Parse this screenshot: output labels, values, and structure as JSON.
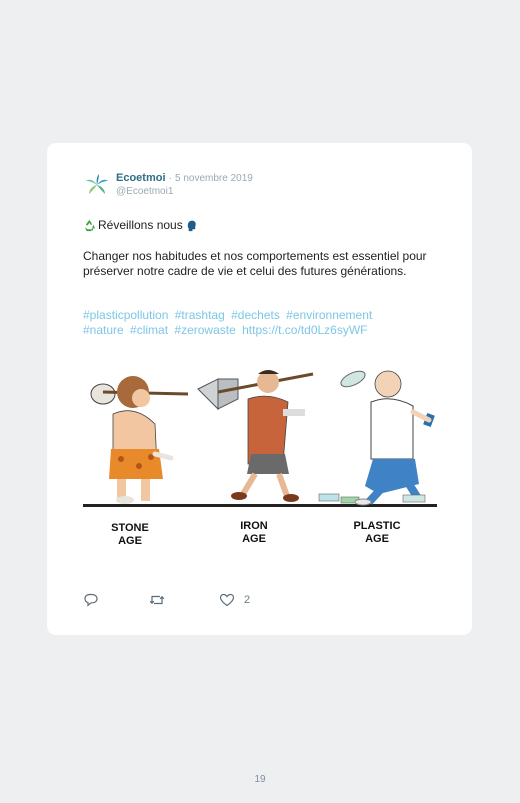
{
  "tweet": {
    "author": "Ecoetmoi",
    "date": "5 novembre 2019",
    "separator": "·",
    "handle": "@Ecoetmoi1",
    "title": "Réveillons nous",
    "body": "Changer nos habitudes et nos comportements est essentiel pour préserver notre cadre de vie et celui des futures générations.",
    "hashtags": [
      "#plasticpollution",
      "#trashtag",
      "#dechets",
      "#environnement",
      "#nature",
      "#climat",
      "#zerowaste"
    ],
    "link": "https://t.co/td0Lz6syWF",
    "image_captions": [
      "STONE",
      "AGE",
      "IRON",
      "AGE",
      "PLASTIC",
      "AGE"
    ],
    "like_count": "2"
  },
  "icons": {
    "avatar": "leaf-logo-icon",
    "recycle": "recycle-icon",
    "speaking_head": "speaking-head-icon",
    "reply": "reply-icon",
    "retweet": "retweet-icon",
    "like": "heart-icon"
  },
  "colors": {
    "author": "#2d6e88",
    "meta": "#9aaab4",
    "hashtag": "#7cc7e6",
    "background": "#eeeff0",
    "card": "#ffffff"
  },
  "page": {
    "number": "19"
  }
}
